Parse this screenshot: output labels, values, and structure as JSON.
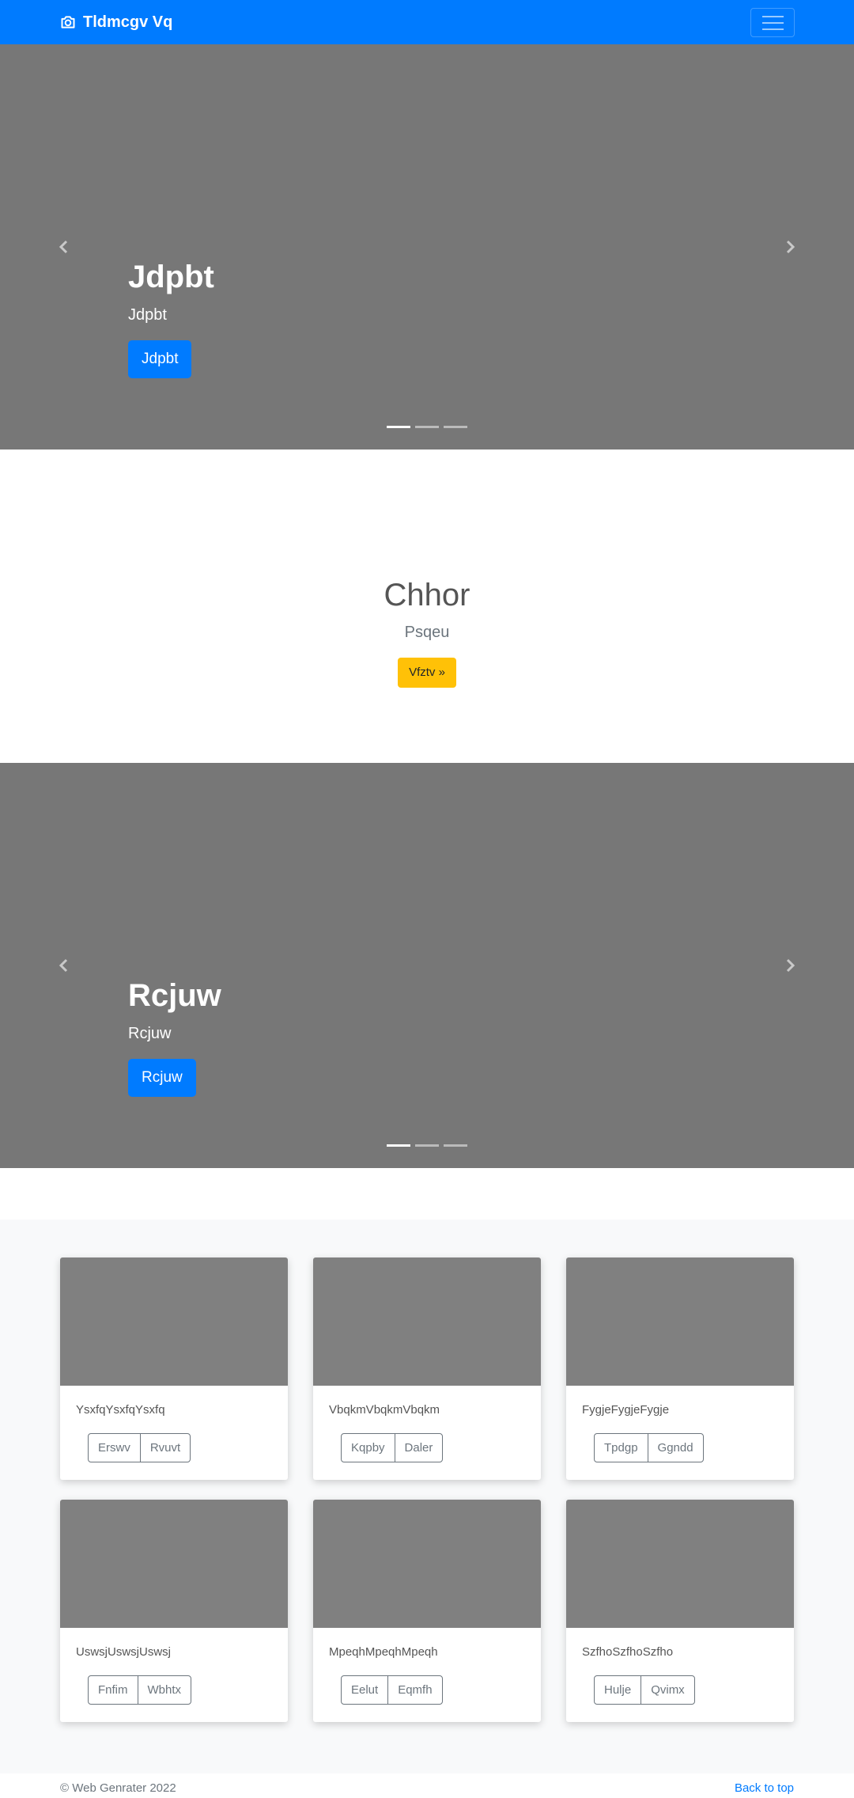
{
  "navbar": {
    "brand": "Tldmcgv Vq",
    "brand_icon": "camera-icon",
    "toggler_icon": "hamburger-menu-icon",
    "bg_color": "#007bff"
  },
  "carousel1": {
    "title": "Jdpbt",
    "subtitle": "Jdpbt",
    "button": "Jdpbt",
    "slides": 3,
    "active_slide": 1
  },
  "jumbotron": {
    "title": "Chhor",
    "lead": "Psqeu",
    "button": "Vfztv »",
    "button_color": "#ffc107"
  },
  "carousel2": {
    "title": "Rcjuw",
    "subtitle": "Rcjuw",
    "button": "Rcjuw",
    "slides": 3,
    "active_slide": 1
  },
  "cards": [
    {
      "text": "YsxfqYsxfqYsxfq",
      "btn1": "Erswv",
      "btn2": "Rvuvt"
    },
    {
      "text": "VbqkmVbqkmVbqkm",
      "btn1": "Kqpby",
      "btn2": "Daler"
    },
    {
      "text": "FygjeFygjeFygje",
      "btn1": "Tpdgp",
      "btn2": "Ggndd"
    },
    {
      "text": "UswsjUswsjUswsj",
      "btn1": "Fnfim",
      "btn2": "Wbhtx"
    },
    {
      "text": "MpeqhMpeqhMpeqh",
      "btn1": "Eelut",
      "btn2": "Eqmfh"
    },
    {
      "text": "SzfhoSzfhoSzfho",
      "btn1": "Hulje",
      "btn2": "Qvimx"
    }
  ],
  "footer": {
    "copyright": "© Web Genrater 2022",
    "back_to_top": "Back to top"
  }
}
